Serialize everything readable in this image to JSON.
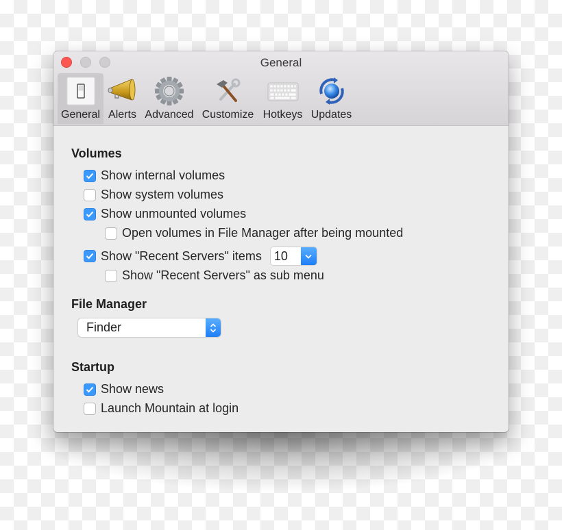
{
  "window": {
    "title": "General",
    "traffic_lights": [
      "close",
      "minimize",
      "zoom"
    ]
  },
  "toolbar": {
    "items": [
      {
        "label": "General",
        "icon": "switch-icon",
        "active": true
      },
      {
        "label": "Alerts",
        "icon": "megaphone-icon",
        "active": false
      },
      {
        "label": "Advanced",
        "icon": "gear-icon",
        "active": false
      },
      {
        "label": "Customize",
        "icon": "tools-icon",
        "active": false
      },
      {
        "label": "Hotkeys",
        "icon": "keyboard-icon",
        "active": false
      },
      {
        "label": "Updates",
        "icon": "update-globe-icon",
        "active": false
      }
    ]
  },
  "volumes": {
    "title": "Volumes",
    "show_internal": {
      "label": "Show internal volumes",
      "checked": true
    },
    "show_system": {
      "label": "Show system volumes",
      "checked": false
    },
    "show_unmounted": {
      "label": "Show unmounted volumes",
      "checked": true
    },
    "open_in_file_manager": {
      "label": "Open volumes in File Manager after being mounted",
      "checked": false
    },
    "show_recent_servers": {
      "label": "Show \"Recent Servers\" items",
      "checked": true,
      "count": "10"
    },
    "recent_servers_submenu": {
      "label": "Show \"Recent Servers\" as sub menu",
      "checked": false
    }
  },
  "file_manager": {
    "title": "File Manager",
    "selected": "Finder"
  },
  "startup": {
    "title": "Startup",
    "show_news": {
      "label": "Show news",
      "checked": true
    },
    "launch_at_login": {
      "label": "Launch Mountain at login",
      "checked": false
    }
  },
  "colors": {
    "accent": "#3b99fc",
    "close": "#fc5753",
    "window_bg": "#ececec"
  }
}
